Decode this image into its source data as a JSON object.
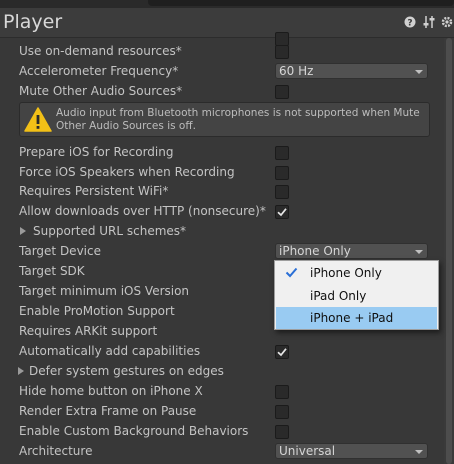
{
  "window": {
    "title": "Player",
    "top_search_text": "",
    "icons": [
      "help-icon",
      "preset-icon",
      "settings-icon"
    ]
  },
  "rows": [
    {
      "label": "Use on-demand resources*",
      "type": "checkbox",
      "checked": false
    },
    {
      "label": "Accelerometer Frequency*",
      "type": "dropdown",
      "value": "60 Hz"
    },
    {
      "label": "Mute Other Audio Sources*",
      "type": "checkbox",
      "checked": false
    },
    {
      "label": "Prepare iOS for Recording",
      "type": "checkbox",
      "checked": false
    },
    {
      "label": "Force iOS Speakers when Recording",
      "type": "checkbox",
      "checked": false
    },
    {
      "label": "Requires Persistent WiFi*",
      "type": "checkbox",
      "checked": false
    },
    {
      "label": "Allow downloads over HTTP (nonsecure)*",
      "type": "checkbox",
      "checked": true
    },
    {
      "label": "Supported URL schemes*",
      "type": "foldout"
    },
    {
      "label": "Target Device",
      "type": "dropdown",
      "value": "iPhone Only"
    },
    {
      "label": "Target SDK"
    },
    {
      "label": "Target minimum iOS Version"
    },
    {
      "label": "Enable ProMotion Support"
    },
    {
      "label": "Requires ARKit support"
    },
    {
      "label": "Automatically add capabilities",
      "type": "checkbox",
      "checked": true
    },
    {
      "label": "Defer system gestures on edges",
      "type": "foldout"
    },
    {
      "label": "Hide home button on iPhone X",
      "type": "checkbox",
      "checked": false
    },
    {
      "label": "Render Extra Frame on Pause",
      "type": "checkbox",
      "checked": false
    },
    {
      "label": "Enable Custom Background Behaviors",
      "type": "checkbox",
      "checked": false
    },
    {
      "label": "Architecture",
      "type": "dropdown",
      "value": "Universal"
    }
  ],
  "warning": {
    "text": "Audio input from Bluetooth microphones is not supported when Mute Other Audio Sources is off."
  },
  "popup": {
    "options": [
      "iPhone Only",
      "iPad Only",
      "iPhone + iPad"
    ],
    "selected": "iPhone Only",
    "highlighted": "iPhone + iPad"
  },
  "colors": {
    "background": "#383838",
    "highlight": "#99cbf2",
    "warning": "#f2c017"
  }
}
